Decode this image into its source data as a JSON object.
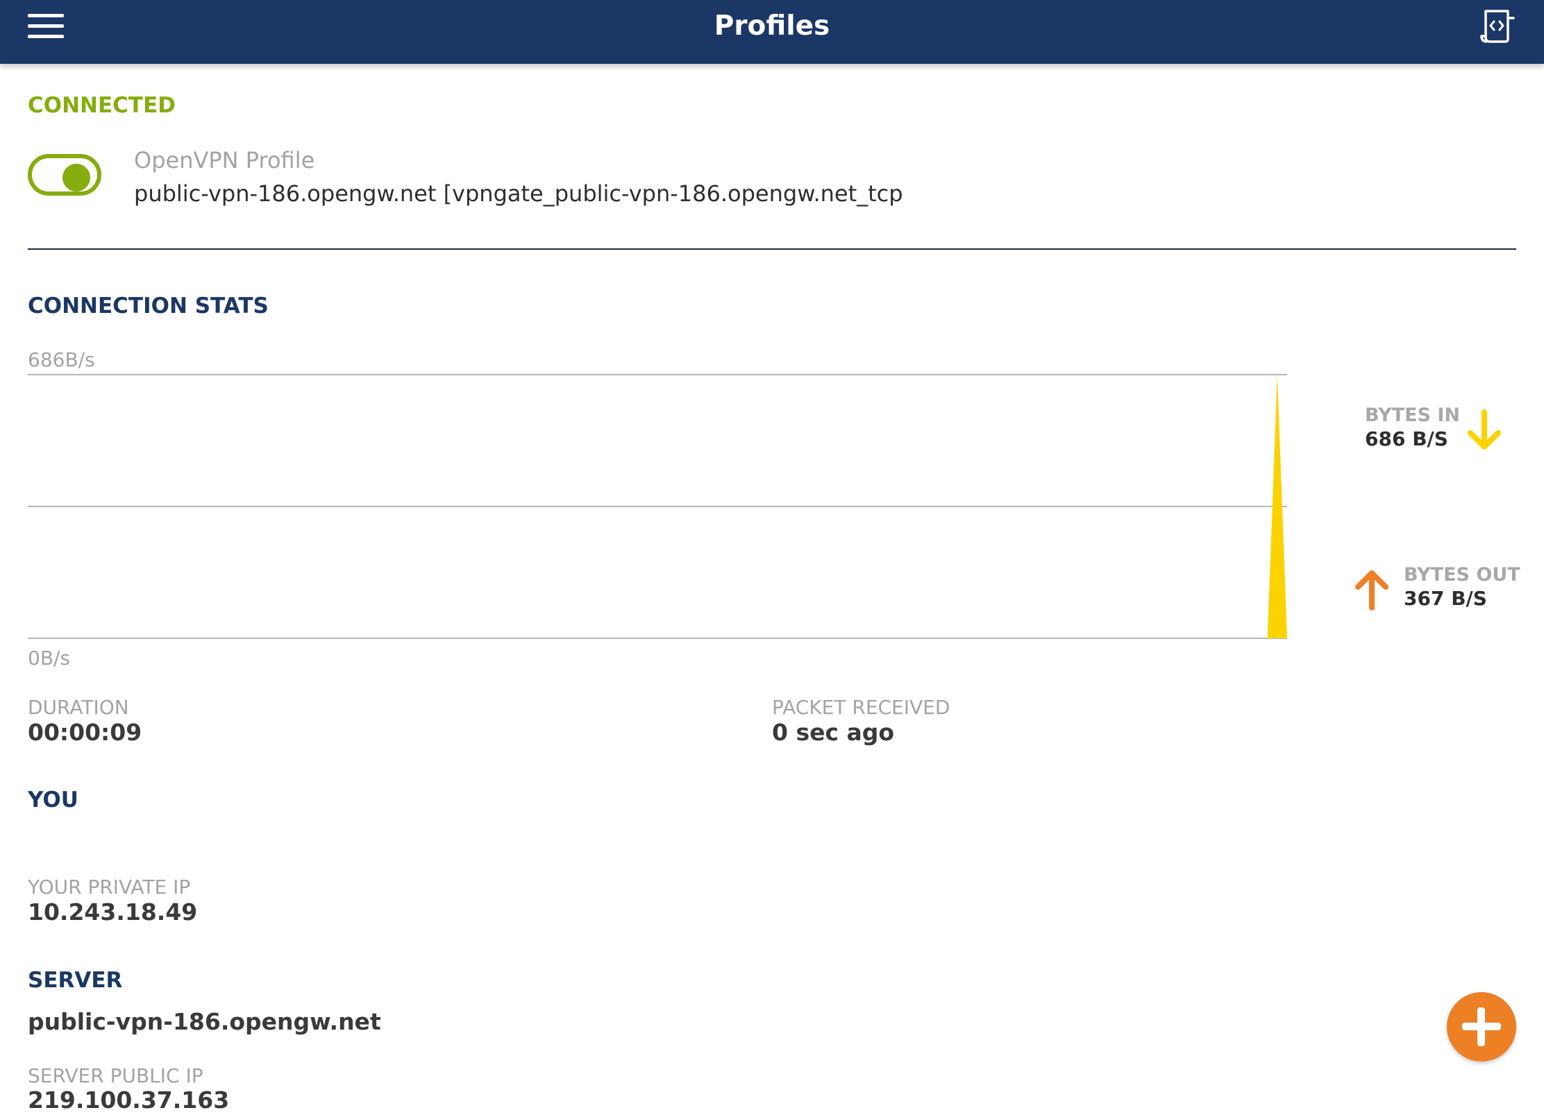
{
  "header": {
    "title": "Profiles",
    "menu_icon": "hamburger-menu-icon",
    "import_icon": "import-profile-icon",
    "color": "#1b3766"
  },
  "connection": {
    "status": "CONNECTED",
    "status_color": "#86ac0e",
    "toggle_on": true,
    "profile_type": "OpenVPN Profile",
    "profile_name": "public-vpn-186.opengw.net [vpngate_public-vpn-186.opengw.net_tcp"
  },
  "stats": {
    "heading": "CONNECTION STATS",
    "chart_max_label": "686B/s",
    "chart_min_label": "0B/s",
    "bytes_in_label": "BYTES IN",
    "bytes_in_value": "686 B/S",
    "bytes_out_label": "BYTES OUT",
    "bytes_out_value": "367 B/S",
    "bytes_in_color": "#fcd200",
    "bytes_out_color": "#ed7f24",
    "duration_label": "DURATION",
    "duration_value": "00:00:09",
    "packet_label": "PACKET RECEIVED",
    "packet_value": "0 sec ago"
  },
  "you": {
    "heading": "YOU",
    "private_ip_label": "YOUR PRIVATE IP",
    "private_ip_value": "10.243.18.49"
  },
  "server": {
    "heading": "SERVER",
    "hostname": "public-vpn-186.opengw.net",
    "public_ip_label": "SERVER PUBLIC IP",
    "public_ip_value": "219.100.37.163"
  },
  "fab": {
    "icon": "plus-icon",
    "color": "#ed7f24"
  },
  "chart_data": {
    "type": "area",
    "ylim": [
      0,
      686
    ],
    "series": [
      {
        "name": "BYTES IN",
        "values": [
          0,
          0,
          0,
          0,
          0,
          0,
          0,
          0,
          0,
          0,
          0,
          0,
          0,
          0,
          0,
          0,
          0,
          0,
          0,
          0,
          0,
          0,
          0,
          0,
          0,
          0,
          0,
          0,
          0,
          0,
          0,
          0,
          0,
          0,
          0,
          0,
          0,
          0,
          0,
          0,
          0,
          0,
          0,
          0,
          0,
          0,
          0,
          0,
          0,
          0,
          0,
          0,
          0,
          0,
          0,
          0,
          0,
          0,
          0,
          0,
          0,
          0,
          0,
          0,
          0,
          0,
          0,
          0,
          0,
          0,
          0,
          0,
          0,
          0,
          0,
          0,
          0,
          0,
          0,
          0,
          0,
          0,
          0,
          0,
          0,
          0,
          0,
          0,
          0,
          0,
          0,
          0,
          0,
          0,
          0,
          0,
          0,
          0,
          0,
          0,
          0,
          0,
          0,
          0,
          0,
          0,
          0,
          0,
          0,
          0,
          0,
          0,
          0,
          0,
          0,
          0,
          0,
          0,
          0,
          0,
          0,
          0,
          0,
          0,
          0,
          0,
          0,
          686,
          0
        ]
      }
    ]
  }
}
